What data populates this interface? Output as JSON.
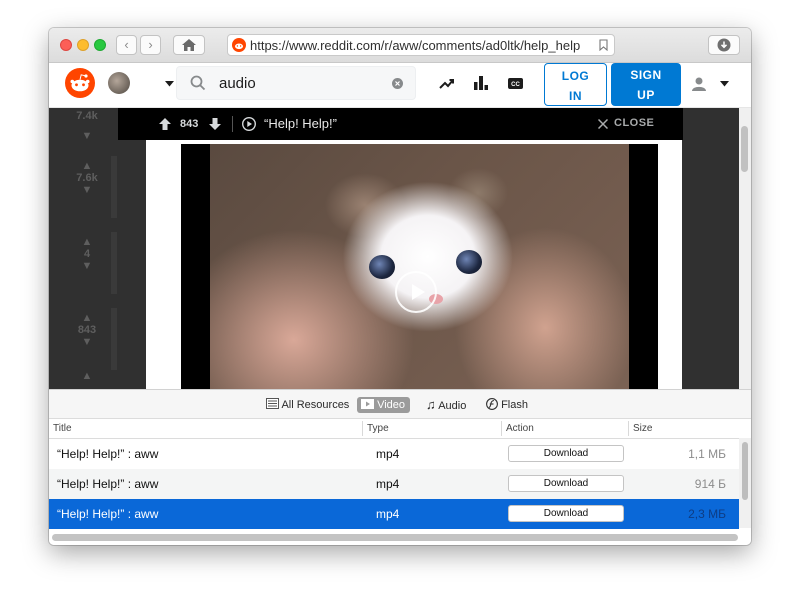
{
  "browser": {
    "url": "https://www.reddit.com/r/aww/comments/ad0ltk/help_help"
  },
  "reddit": {
    "search_value": "audio",
    "login_label_1": "LOG",
    "login_label_2": "IN",
    "signup_label_1": "SIGN",
    "signup_label_2": "UP",
    "brand_color": "#ff4500",
    "accent_color": "#0079d3"
  },
  "feed": {
    "vote_counts": [
      "7.4k",
      "7.6k",
      "4",
      "843"
    ]
  },
  "post": {
    "score": "843",
    "title": "“Help! Help!”",
    "close_label": "CLOSE"
  },
  "resources": {
    "filters": [
      {
        "label": "All Resources",
        "icon": "page-icon",
        "active": false
      },
      {
        "label": "Video",
        "icon": "film-icon",
        "active": true
      },
      {
        "label": "Audio",
        "icon": "music-note-icon",
        "active": false
      },
      {
        "label": "Flash",
        "icon": "flash-icon",
        "active": false
      }
    ],
    "columns": [
      "Title",
      "Type",
      "Action",
      "Size"
    ],
    "download_label": "Download",
    "rows": [
      {
        "title": "“Help! Help!” : aww",
        "type": "mp4",
        "size": "1,1 МБ",
        "selected": false
      },
      {
        "title": "“Help! Help!” : aww",
        "type": "mp4",
        "size": "914 Б",
        "selected": false
      },
      {
        "title": "“Help! Help!” : aww",
        "type": "mp4",
        "size": "2,3 МБ",
        "selected": true
      }
    ]
  }
}
